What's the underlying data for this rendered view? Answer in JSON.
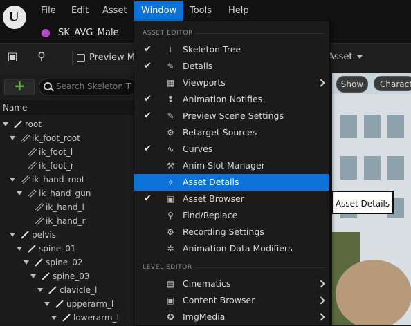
{
  "menubar": {
    "items": [
      "File",
      "Edit",
      "Asset",
      "Window",
      "Tools",
      "Help"
    ],
    "active": "Window"
  },
  "asset_tab": {
    "label": "SK_AVG_Male"
  },
  "toolbar": {
    "preview_label": "Preview Me",
    "asset_label": "Asset"
  },
  "skeleton_panel": {
    "search_placeholder": "Search Skeleton T",
    "column_header": "Name",
    "bones": [
      "root",
      "ik_foot_root",
      "ik_foot_l",
      "ik_foot_r",
      "ik_hand_root",
      "ik_hand_gun",
      "ik_hand_l",
      "ik_hand_r",
      "pelvis",
      "spine_01",
      "spine_02",
      "spine_03",
      "clavicle_l",
      "upperarm_l",
      "lowerarm_l"
    ]
  },
  "viewport": {
    "show_label": "Show",
    "character_label": "Charact"
  },
  "window_menu": {
    "sections": [
      {
        "header": "ASSET EDITOR",
        "items": [
          {
            "label": "Skeleton Tree",
            "checked": true,
            "icon": "skeleton-tree-icon",
            "glyph": "⟊",
            "submenu": false
          },
          {
            "label": "Details",
            "checked": true,
            "icon": "pencil-icon",
            "glyph": "✎",
            "submenu": false
          },
          {
            "label": "Viewports",
            "checked": false,
            "icon": "viewports-icon",
            "glyph": "▦",
            "submenu": true
          },
          {
            "label": "Animation Notifies",
            "checked": true,
            "icon": "notify-icon",
            "glyph": "❢",
            "submenu": false
          },
          {
            "label": "Preview Scene Settings",
            "checked": true,
            "icon": "pencil-icon",
            "glyph": "✎",
            "submenu": false
          },
          {
            "label": "Retarget Sources",
            "checked": false,
            "icon": "retarget-icon",
            "glyph": "⚙",
            "submenu": false
          },
          {
            "label": "Curves",
            "checked": true,
            "icon": "curves-icon",
            "glyph": "∿",
            "submenu": false
          },
          {
            "label": "Anim Slot Manager",
            "checked": false,
            "icon": "slot-manager-icon",
            "glyph": "⚒",
            "submenu": false
          },
          {
            "label": "Asset Details",
            "checked": false,
            "icon": "asset-details-icon",
            "glyph": "✧",
            "submenu": false,
            "highlighted": true
          },
          {
            "label": "Asset Browser",
            "checked": true,
            "icon": "asset-browser-icon",
            "glyph": "▣",
            "submenu": false
          },
          {
            "label": "Find/Replace",
            "checked": false,
            "icon": "search-icon",
            "glyph": "⚲",
            "submenu": false
          },
          {
            "label": "Recording Settings",
            "checked": false,
            "icon": "settings-icon",
            "glyph": "⚙",
            "submenu": false
          },
          {
            "label": "Animation Data Modifiers",
            "checked": false,
            "icon": "modifiers-icon",
            "glyph": "✲",
            "submenu": false
          }
        ]
      },
      {
        "header": "LEVEL EDITOR",
        "items": [
          {
            "label": "Cinematics",
            "checked": false,
            "icon": "clapper-icon",
            "glyph": "▤",
            "submenu": true
          },
          {
            "label": "Content Browser",
            "checked": false,
            "icon": "content-browser-icon",
            "glyph": "▣",
            "submenu": true
          },
          {
            "label": "ImgMedia",
            "checked": false,
            "icon": "media-icon",
            "glyph": "✪",
            "submenu": true
          }
        ]
      }
    ]
  },
  "tooltip": {
    "text": "Asset Details"
  },
  "colors": {
    "accent": "#0d72d8",
    "add_green": "#52c02e",
    "asset_dot": "#b04cc8"
  }
}
